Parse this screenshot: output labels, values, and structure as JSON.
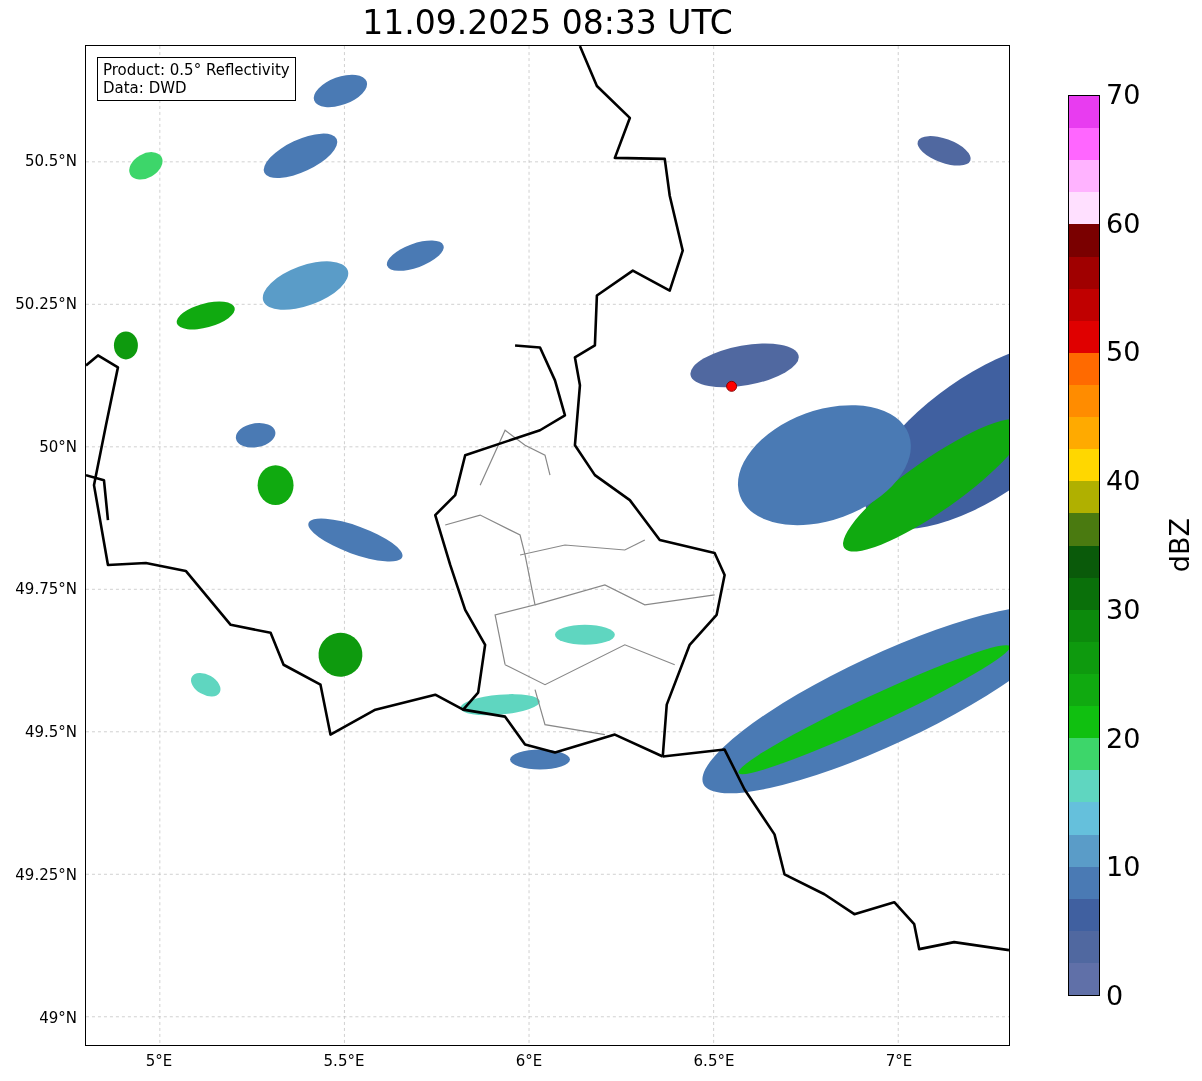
{
  "title": "11.09.2025 08:33 UTC",
  "info_box": {
    "lines": [
      "Product: 0.5° Reflectivity",
      "Data: DWD"
    ]
  },
  "map": {
    "lat_ticks": [
      "50.5°N",
      "50.25°N",
      "50°N",
      "49.75°N",
      "49.5°N",
      "49.25°N",
      "49°N"
    ],
    "lon_ticks": [
      "5°E",
      "5.5°E",
      "6°E",
      "6.5°E",
      "7°E"
    ]
  },
  "colorbar": {
    "label": "dBZ",
    "ticks": [
      "70",
      "60",
      "50",
      "40",
      "30",
      "20",
      "10",
      "0"
    ],
    "bands": [
      {
        "color": "#e83cf0"
      },
      {
        "color": "#ff66ff"
      },
      {
        "color": "#ffb3ff"
      },
      {
        "color": "#ffe0ff"
      },
      {
        "color": "#7a0000"
      },
      {
        "color": "#a00000"
      },
      {
        "color": "#c00000"
      },
      {
        "color": "#e00000"
      },
      {
        "color": "#ff6a00"
      },
      {
        "color": "#ff8c00"
      },
      {
        "color": "#ffaa00"
      },
      {
        "color": "#ffd700"
      },
      {
        "color": "#b0b000"
      },
      {
        "color": "#4a7a10"
      },
      {
        "color": "#0a5a0a"
      },
      {
        "color": "#0a700a"
      },
      {
        "color": "#0c8a0c"
      },
      {
        "color": "#0e9a0e"
      },
      {
        "color": "#10aa10"
      },
      {
        "color": "#10c010"
      },
      {
        "color": "#3dd66a"
      },
      {
        "color": "#5fd6c0"
      },
      {
        "color": "#65c0dc"
      },
      {
        "color": "#5a9cc8"
      },
      {
        "color": "#4a7ab4"
      },
      {
        "color": "#4060a0"
      },
      {
        "color": "#5068a0"
      },
      {
        "color": "#6070a8"
      }
    ]
  }
}
